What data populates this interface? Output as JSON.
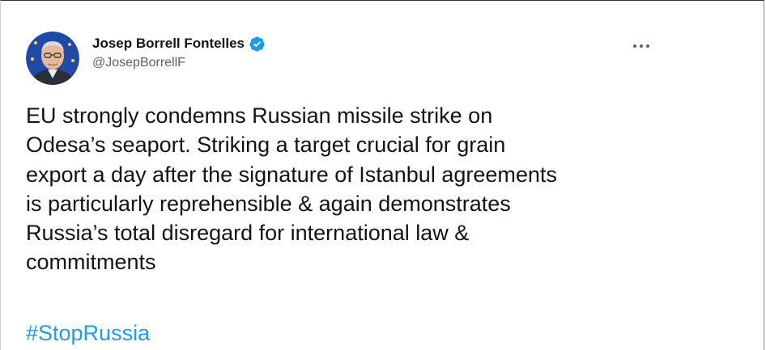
{
  "tweet": {
    "author": {
      "display_name": "Josep Borrell Fontelles",
      "handle": "@JosepBorrellF",
      "verified": true,
      "avatar_icon": "profile-photo"
    },
    "more_icon": "more-horizontal-icon",
    "text": "EU strongly condemns Russian missile strike on\nOdesa’s seaport. Striking a target crucial for grain\nexport a day after the signature of Istanbul agreements\nis particularly reprehensible & again demonstrates\nRussia’s total disregard for international law &\ncommitments",
    "hashtag": "#StopRussia"
  },
  "colors": {
    "text": "#0f1419",
    "secondary": "#536471",
    "link": "#1d9bf0",
    "verified_badge": "#1d9bf0"
  }
}
